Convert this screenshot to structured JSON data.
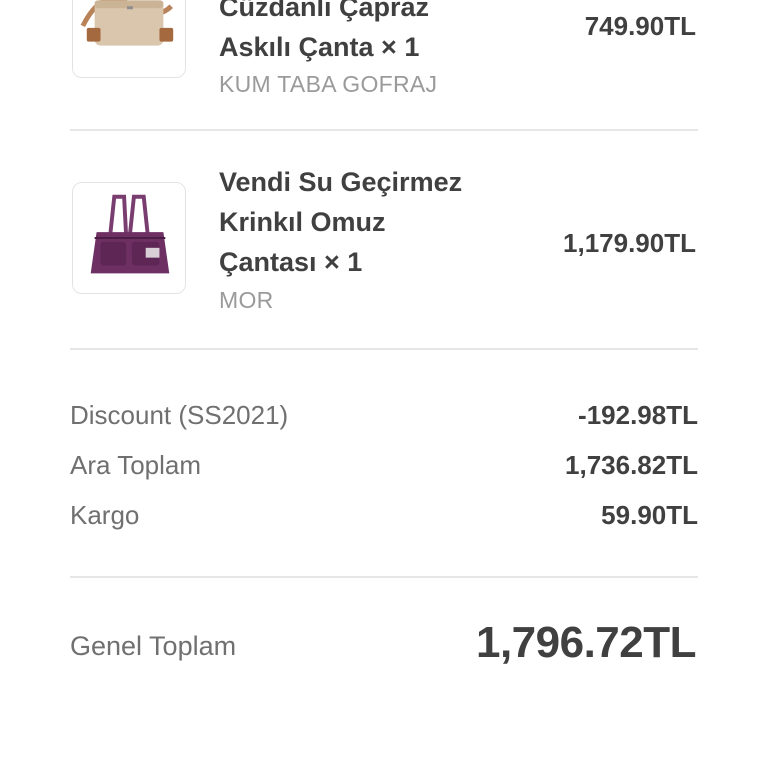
{
  "items": [
    {
      "title_line1": "Cüzdanlı Çapraz",
      "title_line2": "Askılı Çanta × 1",
      "variant": "KUM TABA GOFRAJ",
      "price": "749.90TL"
    },
    {
      "title_line1": "Vendi Su Geçirmez",
      "title_line2": "Krinkıl Omuz",
      "title_line3": "Çantası × 1",
      "variant": "MOR",
      "price": "1,179.90TL"
    }
  ],
  "summary": {
    "discount_label": "Discount (SS2021)",
    "discount_value": "-192.98TL",
    "subtotal_label": "Ara Toplam",
    "subtotal_value": "1,736.82TL",
    "shipping_label": "Kargo",
    "shipping_value": "59.90TL"
  },
  "total": {
    "label": "Genel Toplam",
    "value": "1,796.72TL"
  }
}
